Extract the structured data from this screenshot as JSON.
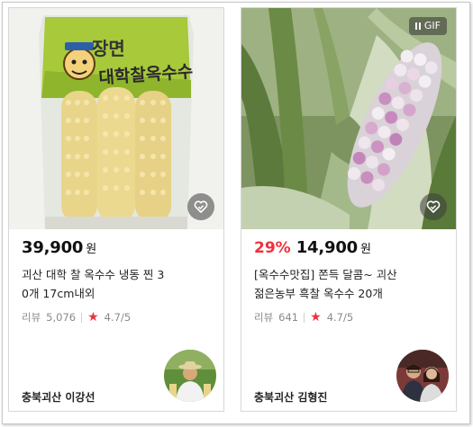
{
  "cards": [
    {
      "price": "39,900",
      "currency": "원",
      "discount": "",
      "title_line1": "괴산 대학 찰 옥수수 냉동 찐 3",
      "title_line2": "0개 17cm내외",
      "review_label": "리뷰",
      "review_count": "5,076",
      "rating": "4.7/5",
      "seller": "충북괴산 이강선",
      "package_text_top": "장면",
      "package_text_main": "대학찰옥수수",
      "wish_icon": "heart-check-icon"
    },
    {
      "price": "14,900",
      "currency": "원",
      "discount": "29%",
      "title_line1": "[옥수수맛집] 쫀득 달콤~ 괴산",
      "title_line2": "젊은농부 흑찰 옥수수 20개",
      "review_label": "리뷰",
      "review_count": "641",
      "rating": "4.7/5",
      "seller": "충북괴산 김형진",
      "gif_label": "GIF",
      "wish_icon": "heart-check-icon"
    }
  ],
  "colors": {
    "discount": "#f0303a",
    "star": "#e8333e",
    "meta": "#8a8a8a"
  }
}
